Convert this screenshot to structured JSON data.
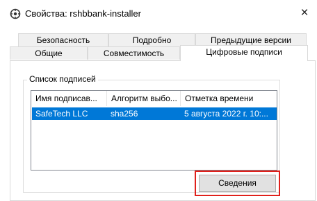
{
  "window": {
    "title": "Свойства: rshbbank-installer",
    "icon": "properties-icon",
    "close_glyph": "×"
  },
  "tabs": {
    "row1": [
      "Безопасность",
      "Подробно",
      "Предыдущие версии"
    ],
    "row2": [
      "Общие",
      "Совместимость",
      "Цифровые подписи"
    ],
    "active": "Цифровые подписи"
  },
  "signatures": {
    "group_label": "Список подписей",
    "columns": [
      "Имя подписав...",
      "Алгоритм выбо...",
      "Отметка времени"
    ],
    "rows": [
      {
        "name": "SafeTech LLC",
        "algorithm": "sha256",
        "timestamp": "5 августа 2022 г. 10:..."
      }
    ],
    "selection_color": "#0078d7"
  },
  "buttons": {
    "details_label": "Сведения"
  },
  "highlight_color": "#e0201b"
}
